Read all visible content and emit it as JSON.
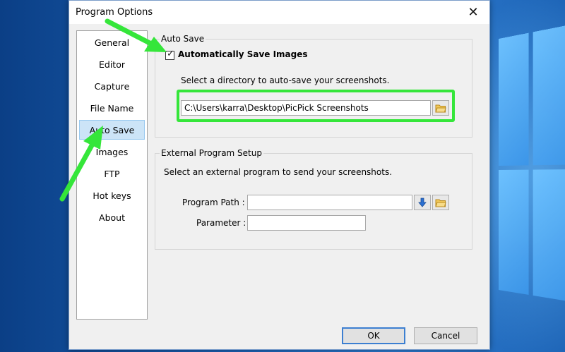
{
  "dialog": {
    "title": "Program Options",
    "close_glyph": "✕"
  },
  "sidebar": {
    "items": [
      {
        "label": "General"
      },
      {
        "label": "Editor"
      },
      {
        "label": "Capture"
      },
      {
        "label": "File Name"
      },
      {
        "label": "Auto Save",
        "selected": true
      },
      {
        "label": "Images"
      },
      {
        "label": "FTP"
      },
      {
        "label": "Hot keys"
      },
      {
        "label": "About"
      }
    ]
  },
  "auto_save": {
    "legend": "Auto Save",
    "checkbox_label": "Automatically Save Images",
    "checked": true,
    "description": "Select a directory to auto-save your screenshots.",
    "directory_value": "C:\\Users\\karra\\Desktop\\PicPick Screenshots"
  },
  "external_program": {
    "legend": "External Program Setup",
    "description": "Select an external program to send your screenshots.",
    "program_path_label": "Program Path :",
    "program_path_value": "",
    "parameter_label": "Parameter :",
    "parameter_value": ""
  },
  "buttons": {
    "ok": "OK",
    "cancel": "Cancel"
  },
  "annotations": {
    "highlight_color": "#35e63a"
  }
}
